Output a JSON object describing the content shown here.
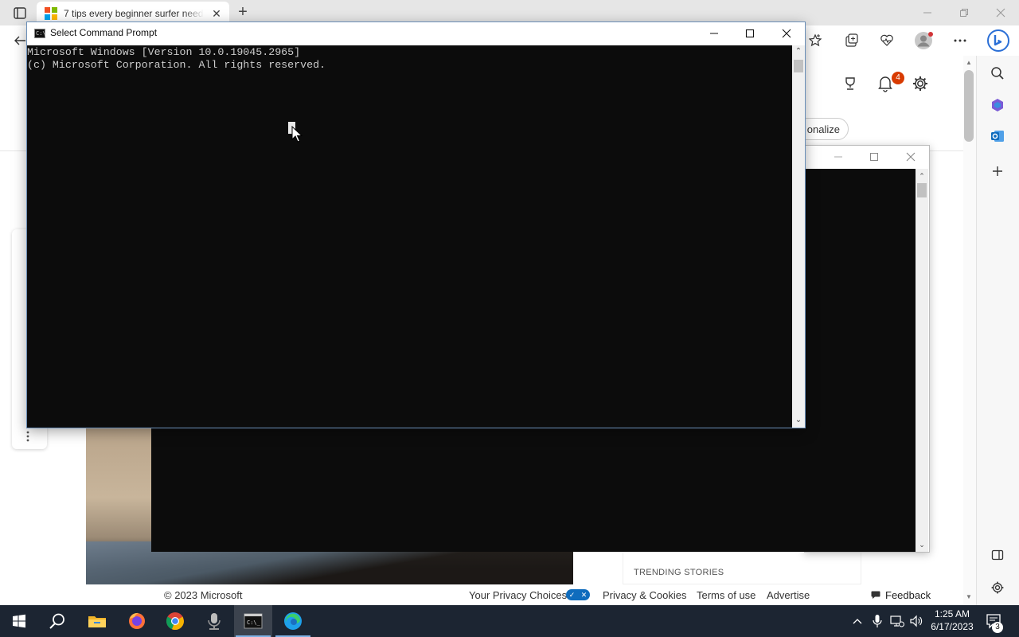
{
  "browser": {
    "tab": {
      "title": "7 tips every beginner surfer need",
      "favicon": "microsoft-logo-icon",
      "favicon_colors": [
        "#f25022",
        "#7fba00",
        "#00a4ef",
        "#ffb900"
      ]
    },
    "notifications_count": "4",
    "personalize_label": "onalize",
    "accent": "#0f6cbd"
  },
  "page": {
    "trending_label": "TRENDING STORIES",
    "footer": {
      "copyright": "© 2023 Microsoft",
      "privacy_choices": "Your Privacy Choices",
      "privacy_cookies": "Privacy & Cookies",
      "terms": "Terms of use",
      "advertise": "Advertise",
      "feedback": "Feedback"
    }
  },
  "cmd": {
    "title": "Select Command Prompt",
    "lines": [
      "Microsoft Windows [Version 10.0.19045.2965]",
      "(c) Microsoft Corporation. All rights reserved."
    ],
    "background": "#0c0c0c",
    "foreground": "#cccccc"
  },
  "taskbar": {
    "apps": [
      "start-icon",
      "search-icon",
      "file-explorer-icon",
      "firefox-icon",
      "chrome-icon",
      "microphone-app-icon",
      "command-prompt-icon",
      "edge-icon"
    ],
    "clock_time": "1:25 AM",
    "clock_date": "6/17/2023",
    "notification_count": "3",
    "background": "#1c2532"
  }
}
